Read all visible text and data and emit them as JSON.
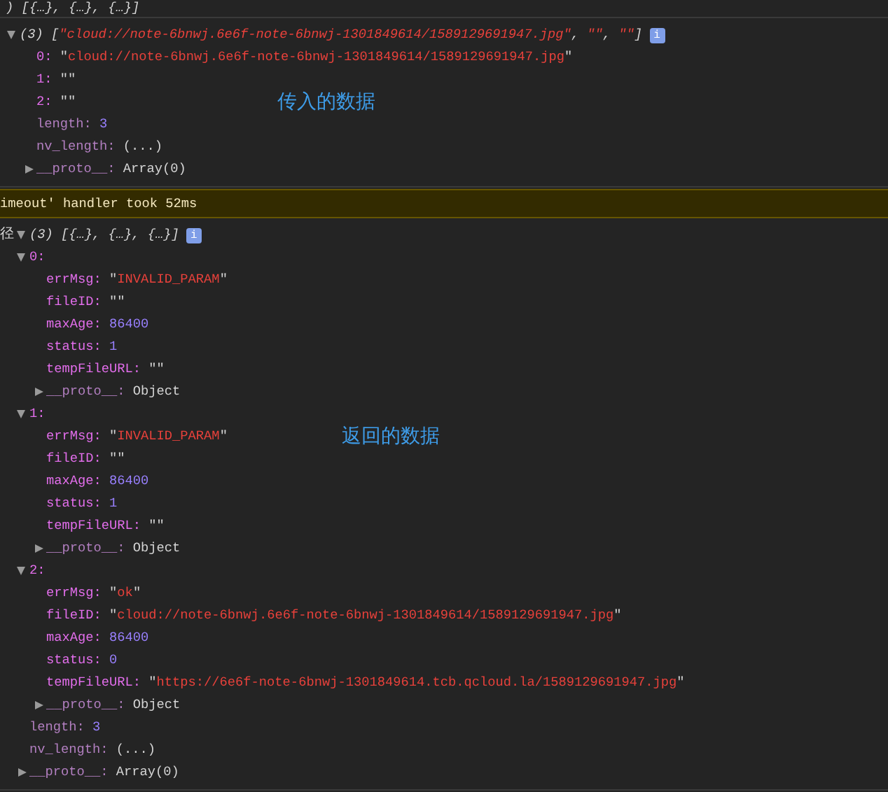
{
  "top_cut": ") [{…}, {…}, {…}]",
  "entries": [
    {
      "kind": "log",
      "expanded": true,
      "summary": [
        {
          "kind": "punct",
          "text": "(3) ["
        },
        {
          "kind": "string",
          "text": "\"cloud://note-6bnwj.6e6f-note-6bnwj-1301849614/1589129691947.jpg\""
        },
        {
          "kind": "punct",
          "text": ", "
        },
        {
          "kind": "string",
          "text": "\"\""
        },
        {
          "kind": "punct",
          "text": ", "
        },
        {
          "kind": "string",
          "text": "\"\""
        },
        {
          "kind": "punct",
          "text": "]"
        }
      ],
      "badge": "i",
      "children": [
        {
          "key": "0:",
          "own": true,
          "value": {
            "kind": "string",
            "text": "\"cloud://note-6bnwj.6e6f-note-6bnwj-1301849614/1589129691947.jpg\""
          }
        },
        {
          "key": "1:",
          "own": true,
          "value": {
            "kind": "string",
            "text": "\"\""
          }
        },
        {
          "key": "2:",
          "own": true,
          "value": {
            "kind": "string",
            "text": "\"\""
          },
          "note": "传入的数据"
        },
        {
          "key": "length:",
          "own": false,
          "value": {
            "kind": "number",
            "text": "3"
          }
        },
        {
          "key": "nv_length:",
          "own": false,
          "value": {
            "kind": "plain",
            "text": "(...)"
          }
        },
        {
          "key": "__proto__:",
          "own": false,
          "expanded": false,
          "value": {
            "kind": "plain",
            "text": "Array(0)"
          }
        }
      ]
    },
    {
      "kind": "warning",
      "text": "imeout' handler took 52ms"
    },
    {
      "kind": "log",
      "prefix": "径",
      "expanded": true,
      "summary": [
        {
          "kind": "punct",
          "text": "(3) [{…}, {…}, {…}]"
        }
      ],
      "badge": "i",
      "children": [
        {
          "key": "0:",
          "own": true,
          "expanded": true,
          "children": [
            {
              "key": "errMsg:",
              "own": true,
              "value": {
                "kind": "string",
                "text": "\"INVALID_PARAM\""
              }
            },
            {
              "key": "fileID:",
              "own": true,
              "value": {
                "kind": "string",
                "text": "\"\""
              }
            },
            {
              "key": "maxAge:",
              "own": true,
              "value": {
                "kind": "number",
                "text": "86400"
              }
            },
            {
              "key": "status:",
              "own": true,
              "value": {
                "kind": "number",
                "text": "1"
              }
            },
            {
              "key": "tempFileURL:",
              "own": true,
              "value": {
                "kind": "string",
                "text": "\"\""
              }
            },
            {
              "key": "__proto__:",
              "own": false,
              "expanded": false,
              "value": {
                "kind": "plain",
                "text": "Object"
              }
            }
          ]
        },
        {
          "key": "1:",
          "own": true,
          "expanded": true,
          "children": [
            {
              "key": "errMsg:",
              "own": true,
              "value": {
                "kind": "string",
                "text": "\"INVALID_PARAM\""
              },
              "note": "返回的数据"
            },
            {
              "key": "fileID:",
              "own": true,
              "value": {
                "kind": "string",
                "text": "\"\""
              }
            },
            {
              "key": "maxAge:",
              "own": true,
              "value": {
                "kind": "number",
                "text": "86400"
              }
            },
            {
              "key": "status:",
              "own": true,
              "value": {
                "kind": "number",
                "text": "1"
              }
            },
            {
              "key": "tempFileURL:",
              "own": true,
              "value": {
                "kind": "string",
                "text": "\"\""
              }
            },
            {
              "key": "__proto__:",
              "own": false,
              "expanded": false,
              "value": {
                "kind": "plain",
                "text": "Object"
              }
            }
          ]
        },
        {
          "key": "2:",
          "own": true,
          "expanded": true,
          "children": [
            {
              "key": "errMsg:",
              "own": true,
              "value": {
                "kind": "string",
                "text": "\"ok\""
              }
            },
            {
              "key": "fileID:",
              "own": true,
              "value": {
                "kind": "string",
                "text": "\"cloud://note-6bnwj.6e6f-note-6bnwj-1301849614/1589129691947.jpg\""
              }
            },
            {
              "key": "maxAge:",
              "own": true,
              "value": {
                "kind": "number",
                "text": "86400"
              }
            },
            {
              "key": "status:",
              "own": true,
              "value": {
                "kind": "number",
                "text": "0"
              }
            },
            {
              "key": "tempFileURL:",
              "own": true,
              "value": {
                "kind": "string",
                "text": "\"https://6e6f-note-6bnwj-1301849614.tcb.qcloud.la/1589129691947.jpg\""
              }
            },
            {
              "key": "__proto__:",
              "own": false,
              "expanded": false,
              "value": {
                "kind": "plain",
                "text": "Object"
              }
            }
          ]
        },
        {
          "key": "length:",
          "own": false,
          "value": {
            "kind": "number",
            "text": "3"
          }
        },
        {
          "key": "nv_length:",
          "own": false,
          "value": {
            "kind": "plain",
            "text": "(...)"
          }
        },
        {
          "key": "__proto__:",
          "own": false,
          "expanded": false,
          "value": {
            "kind": "plain",
            "text": "Array(0)"
          }
        }
      ]
    }
  ]
}
